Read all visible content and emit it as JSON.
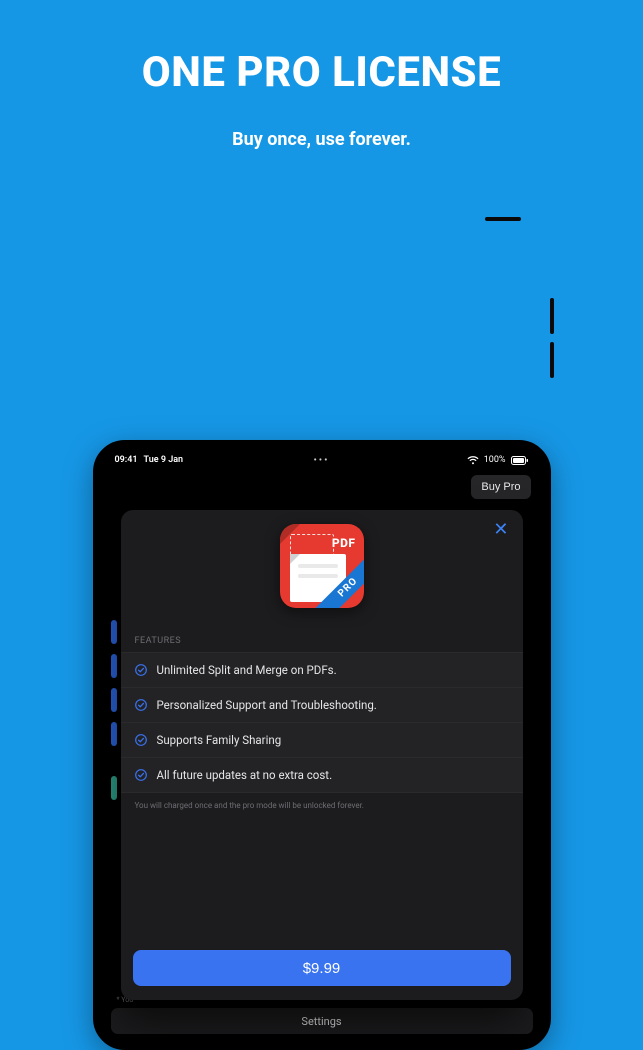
{
  "hero": {
    "title": "ONE PRO LICENSE",
    "subtitle": "Buy once, use forever."
  },
  "statusbar": {
    "time": "09:41",
    "date": "Tue 9 Jan",
    "battery_pct": "100%"
  },
  "topbar": {
    "buy_pro": "Buy Pro"
  },
  "modal": {
    "icon": {
      "badge": "PDF",
      "ribbon": "PRO"
    },
    "features_header": "FEATURES",
    "features": [
      "Unlimited Split and Merge on PDFs.",
      "Personalized Support and Troubleshooting.",
      "Supports Family Sharing",
      "All future updates at no extra cost."
    ],
    "disclaimer": "You will charged once and the pro mode will be unlocked forever.",
    "price_label": "$9.99"
  },
  "background": {
    "footer_note_prefix": "* You",
    "settings_label": "Settings"
  }
}
